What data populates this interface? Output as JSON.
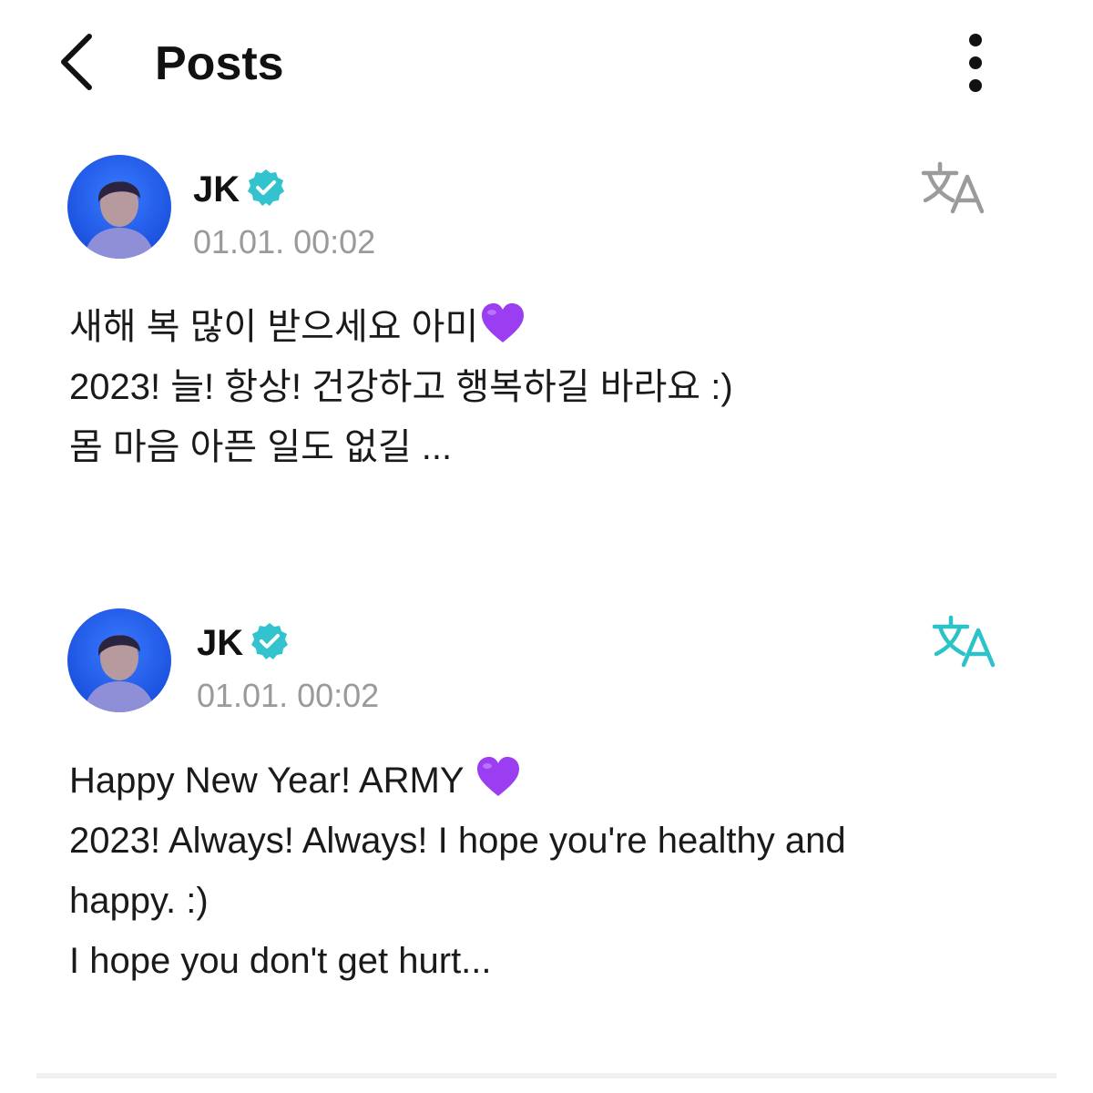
{
  "header": {
    "title": "Posts",
    "back_icon": "chevron-left-icon",
    "more_icon": "more-vertical-icon"
  },
  "posts": [
    {
      "author": "JK",
      "verified_icon": "verified-badge-icon",
      "timestamp": "01.01. 00:02",
      "translate_icon": "translate-icon",
      "translate_active": false,
      "lines": [
        "새해 복 많이 받으세요 아미",
        "2023! 늘! 항상! 건강하고 행복하길 바라요 :)",
        "몸 마음 아픈 일도 없길 ..."
      ],
      "emoji": "purple-heart"
    },
    {
      "author": "JK",
      "verified_icon": "verified-badge-icon",
      "timestamp": "01.01. 00:02",
      "translate_icon": "translate-icon",
      "translate_active": true,
      "lines": [
        "Happy New Year! ARMY ",
        "2023! Always! Always! I hope you're healthy and",
        "happy. :)",
        "I hope you don't get hurt..."
      ],
      "emoji": "purple-heart"
    }
  ],
  "colors": {
    "verified": "#33c3cf",
    "translate_active": "#2cc2c9",
    "translate_inactive": "#9b9b9b",
    "timestamp": "#9a9a9a",
    "heart": "#9b3df0"
  }
}
